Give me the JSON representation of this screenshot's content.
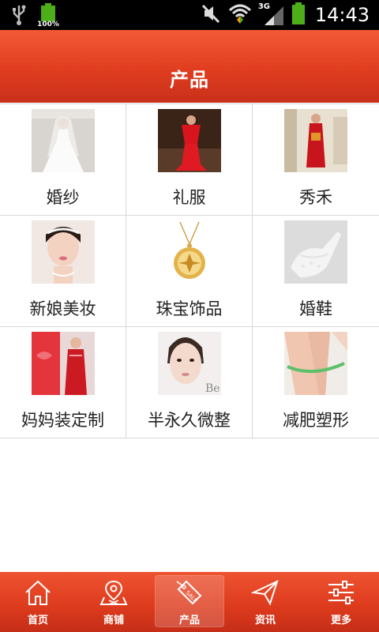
{
  "status_bar": {
    "battery_percent": "100%",
    "network": "3G",
    "time": "14:43"
  },
  "header": {
    "title": "产品"
  },
  "products": [
    {
      "label": "婚纱",
      "icon": "wedding-dress-photo"
    },
    {
      "label": "礼服",
      "icon": "evening-gown-photo"
    },
    {
      "label": "秀禾",
      "icon": "xiuhe-dress-photo"
    },
    {
      "label": "新娘美妆",
      "icon": "bridal-makeup-photo"
    },
    {
      "label": "珠宝饰品",
      "icon": "jewelry-pendant-photo"
    },
    {
      "label": "婚鞋",
      "icon": "wedding-shoes-photo"
    },
    {
      "label": "妈妈装定制",
      "icon": "mother-dress-photo"
    },
    {
      "label": "半永久微整",
      "icon": "semi-permanent-photo"
    },
    {
      "label": "减肥塑形",
      "icon": "slimming-photo"
    }
  ],
  "tabs": [
    {
      "label": "首页",
      "icon": "home-icon"
    },
    {
      "label": "商铺",
      "icon": "map-pin-icon"
    },
    {
      "label": "产品",
      "icon": "sale-tag-icon",
      "active": true
    },
    {
      "label": "资讯",
      "icon": "paper-plane-icon"
    },
    {
      "label": "更多",
      "icon": "sliders-icon"
    }
  ],
  "colors": {
    "header_red": "#e03d1f",
    "tab_red": "#dc3a1c"
  }
}
